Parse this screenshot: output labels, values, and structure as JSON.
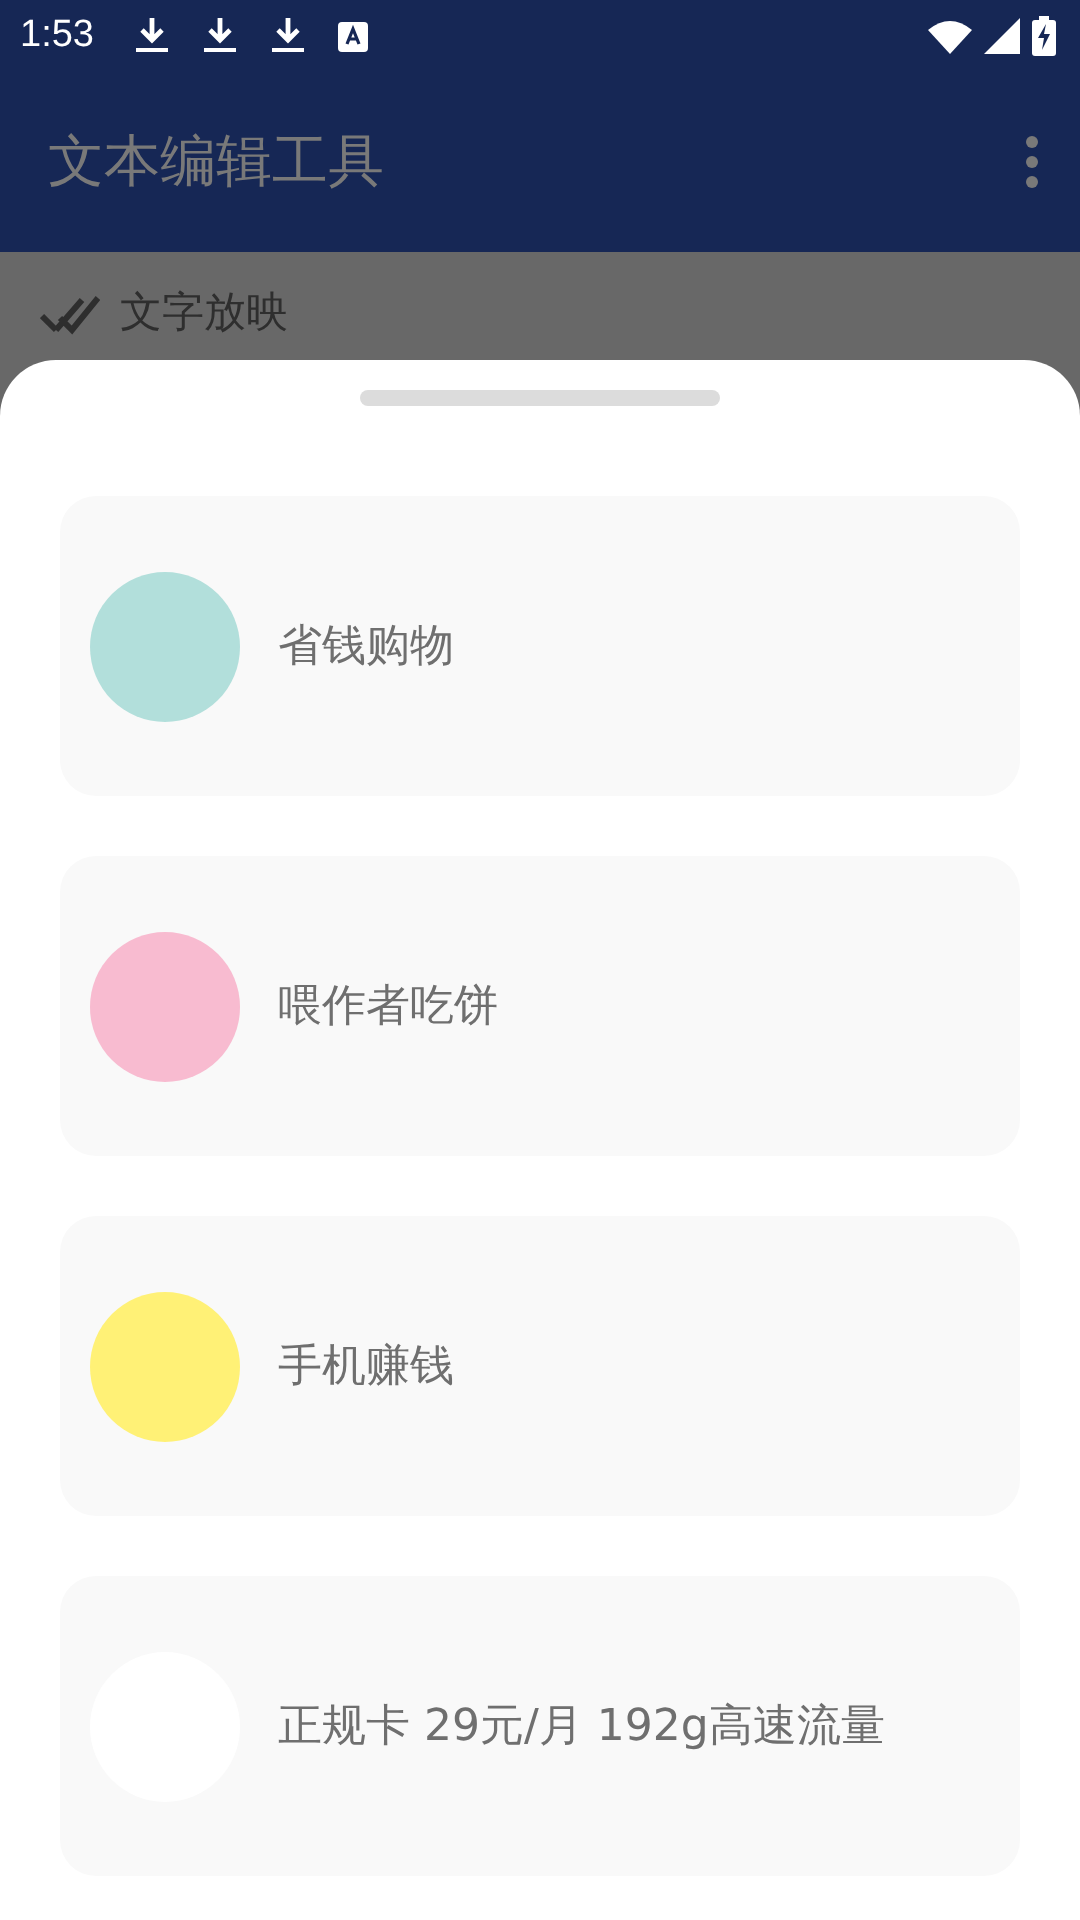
{
  "status_bar": {
    "time": "1:53"
  },
  "app_bar": {
    "title": "文本编辑工具"
  },
  "background_item": {
    "label": "文字放映"
  },
  "sheet": {
    "items": [
      {
        "label": "省钱购物",
        "color": "#b2dfdb"
      },
      {
        "label": "喂作者吃饼",
        "color": "#f8bbd0"
      },
      {
        "label": "手机赚钱",
        "color": "#fff176"
      },
      {
        "label": "正规卡 29元/月 192g高速流量",
        "color": "#ffffff"
      }
    ]
  }
}
